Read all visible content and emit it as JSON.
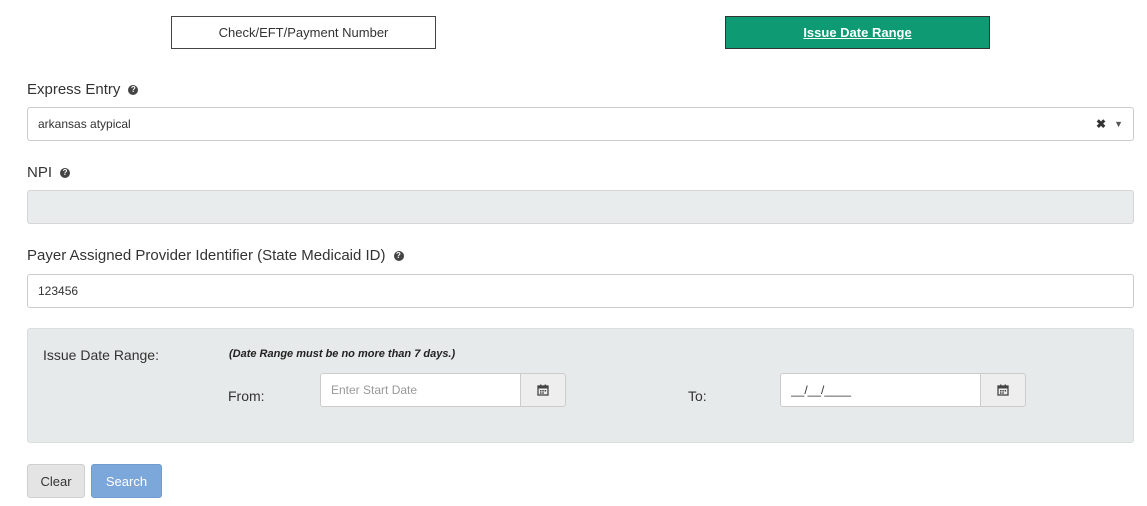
{
  "search_mode": {
    "check_label": "Check/EFT/Payment Number",
    "date_label": "Issue Date Range"
  },
  "express_entry": {
    "label": "Express Entry",
    "value": "arkansas atypical",
    "clear_glyph": "✖",
    "caret_glyph": "▼"
  },
  "npi": {
    "label": "NPI",
    "value": ""
  },
  "payer_id": {
    "label": "Payer Assigned Provider Identifier (State Medicaid ID)",
    "value": "123456"
  },
  "date_range": {
    "title": "Issue Date Range:",
    "note": "(Date Range must be no more than 7 days.)",
    "from_label": "From:",
    "from_placeholder": "Enter Start Date",
    "to_label": "To:",
    "to_value": "__/__/____"
  },
  "actions": {
    "clear_label": "Clear",
    "search_label": "Search"
  },
  "icons": {
    "help": "help-circle-icon",
    "calendar": "calendar-icon"
  },
  "colors": {
    "active_tab": "#0e9a73",
    "search_button": "#7ca7da",
    "panel_background": "#e7eaea"
  }
}
